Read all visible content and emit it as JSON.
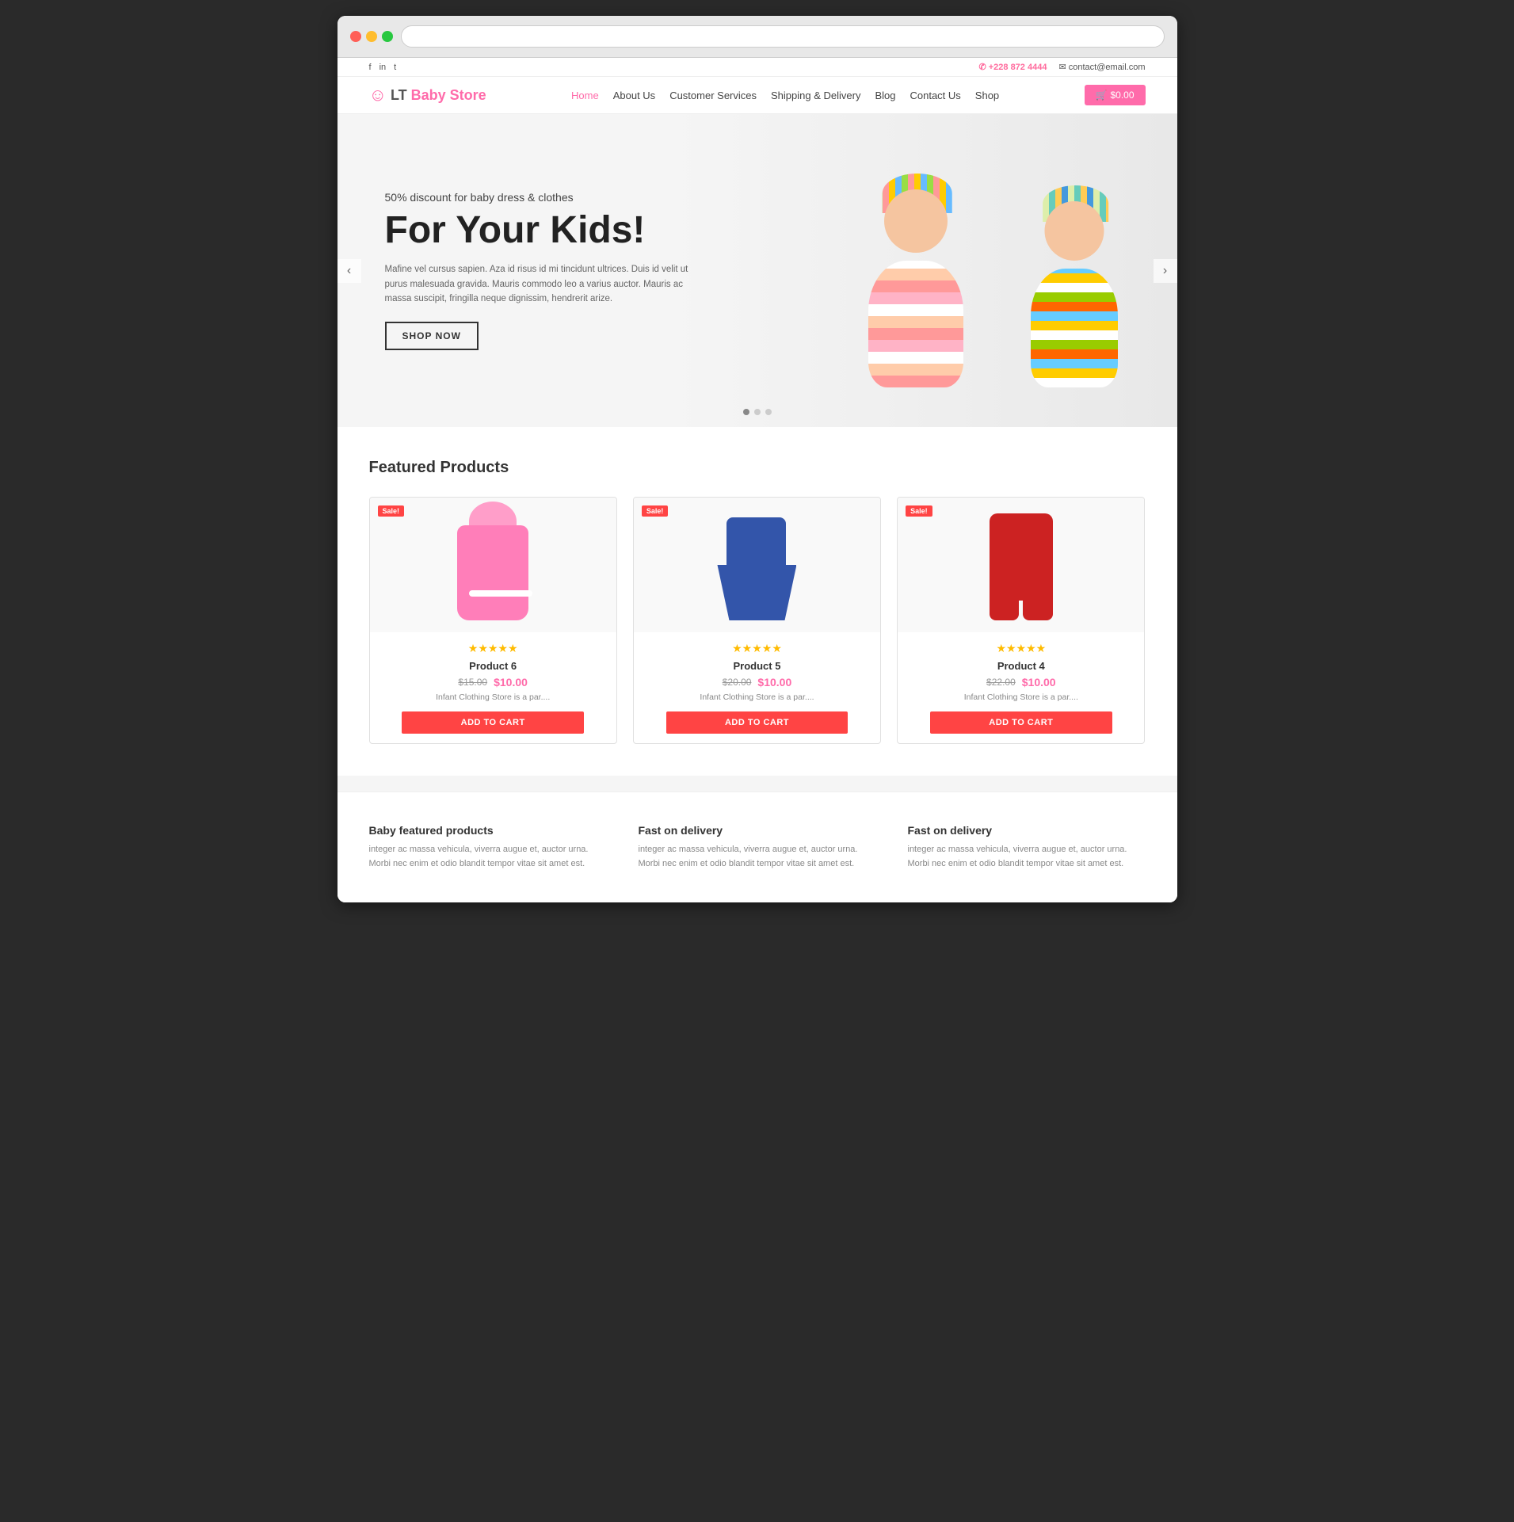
{
  "browser": {
    "address": ""
  },
  "topbar": {
    "social": {
      "facebook": "f",
      "linkedin": "in",
      "twitter": "t"
    },
    "phone": "+228 872 4444",
    "phone_icon": "✆",
    "email": "contact@email.com",
    "email_icon": "✉"
  },
  "header": {
    "logo_icon": "☺",
    "logo_lt": "LT",
    "logo_name": "Baby Store",
    "nav": {
      "home": "Home",
      "about": "About Us",
      "customer": "Customer Services",
      "shipping": "Shipping & Delivery",
      "blog": "Blog",
      "contact": "Contact Us",
      "shop": "Shop"
    },
    "cart": "$0.00"
  },
  "hero": {
    "subtitle": "50% discount for baby dress & clothes",
    "title": "For Your Kids!",
    "description": "Mafine vel cursus sapien. Aza id risus id mi tincidunt ultrices. Duis id velit ut purus malesuada gravida. Mauris commodo leo a varius auctor. Mauris ac massa suscipit, fringilla neque dignissim, hendrerit arize.",
    "cta": "SHOP NOW",
    "nav_prev": "‹",
    "nav_next": "›",
    "dots": [
      1,
      2,
      3
    ]
  },
  "featured": {
    "title": "Featured Products",
    "products": [
      {
        "id": 6,
        "sale_badge": "Sale!",
        "name": "Product 6",
        "old_price": "$15.00",
        "new_price": "$10.00",
        "desc": "Infant Clothing Store is a par....",
        "stars": "★★★★★",
        "add_to_cart": "ADD TO CART"
      },
      {
        "id": 5,
        "sale_badge": "Sale!",
        "name": "Product 5",
        "old_price": "$20.00",
        "new_price": "$10.00",
        "desc": "Infant Clothing Store is a par....",
        "stars": "★★★★★",
        "add_to_cart": "ADD TO CART"
      },
      {
        "id": 4,
        "sale_badge": "Sale!",
        "name": "Product 4",
        "old_price": "$22.00",
        "new_price": "$10.00",
        "desc": "Infant Clothing Store is a par....",
        "stars": "★★★★★",
        "add_to_cart": "ADD TO CART"
      }
    ]
  },
  "features": [
    {
      "title": "Baby featured products",
      "text": "integer ac massa vehicula, viverra augue et, auctor urna. Morbi nec enim et odio blandit tempor vitae sit amet est."
    },
    {
      "title": "Fast on delivery",
      "text": "integer ac massa vehicula, viverra augue et, auctor urna. Morbi nec enim et odio blandit tempor vitae sit amet est."
    },
    {
      "title": "Fast on delivery",
      "text": "integer ac massa vehicula, viverra augue et, auctor urna. Morbi nec enim et odio blandit tempor vitae sit amet est."
    }
  ]
}
